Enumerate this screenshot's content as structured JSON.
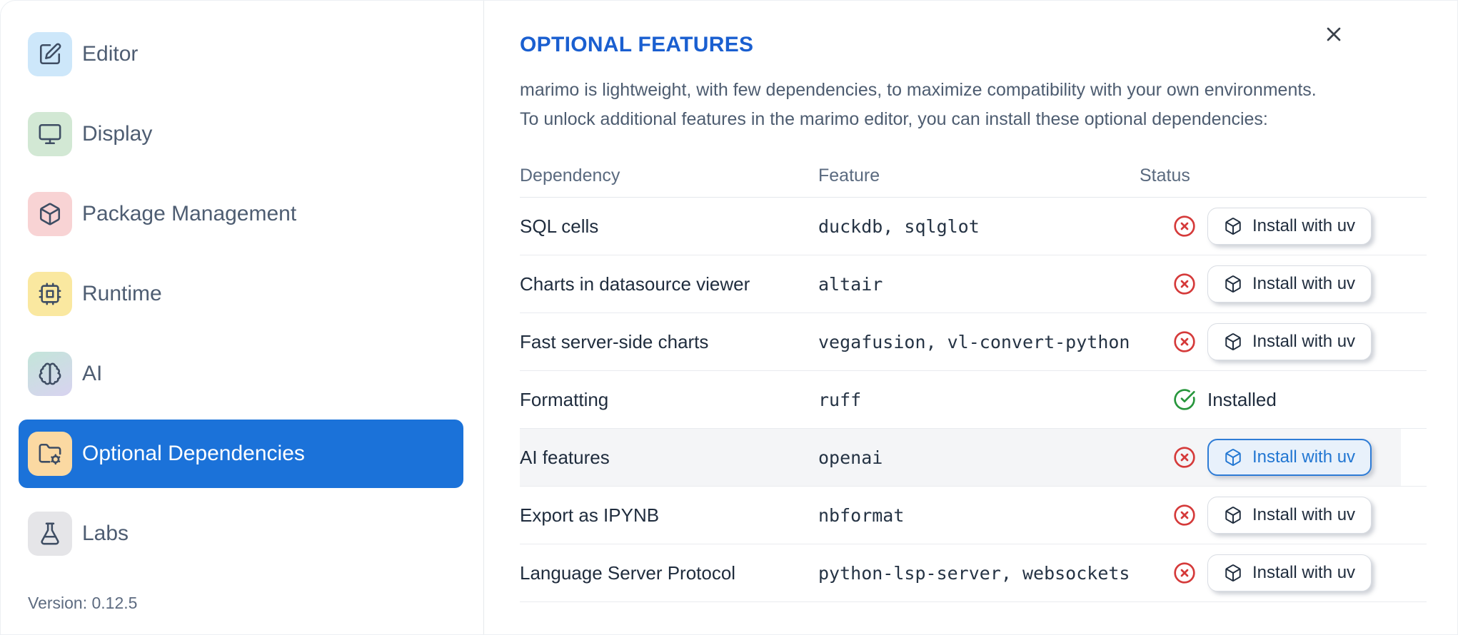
{
  "sidebar": {
    "items": [
      {
        "label": "Editor",
        "icon": "edit-icon",
        "tile": "#cde7fa"
      },
      {
        "label": "Display",
        "icon": "display-icon",
        "tile": "#d2e8d4"
      },
      {
        "label": "Package Management",
        "icon": "package-icon",
        "tile": "#f8d3d4"
      },
      {
        "label": "Runtime",
        "icon": "cpu-icon",
        "tile": "#fae8a0"
      },
      {
        "label": "AI",
        "icon": "brain-icon",
        "tile": "linear-gradient(155deg,#c3e5d9,#d8d3f0)"
      },
      {
        "label": "Optional Dependencies",
        "icon": "folder-cog-icon",
        "tile": "#fbd9a2"
      },
      {
        "label": "Labs",
        "icon": "flask-icon",
        "tile": "#e5e5e8"
      }
    ],
    "selected_index": 5,
    "version_label": "Version: 0.12.5"
  },
  "main": {
    "title": "OPTIONAL FEATURES",
    "description_line1": "marimo is lightweight, with few dependencies, to maximize compatibility with your own environments.",
    "description_line2": "To unlock additional features in the marimo editor, you can install these optional dependencies:",
    "close_icon": "x-icon",
    "table": {
      "headers": [
        "Dependency",
        "Feature",
        "Status"
      ],
      "install_action_label": "Install with uv",
      "installed_label": "Installed",
      "rows": [
        {
          "dependency": "SQL cells",
          "feature": "duckdb, sqlglot",
          "installed": false,
          "highlighted": false
        },
        {
          "dependency": "Charts in datasource viewer",
          "feature": "altair",
          "installed": false,
          "highlighted": false
        },
        {
          "dependency": "Fast server-side charts",
          "feature": "vegafusion, vl-convert-python",
          "installed": false,
          "highlighted": false
        },
        {
          "dependency": "Formatting",
          "feature": "ruff",
          "installed": true,
          "highlighted": false
        },
        {
          "dependency": "AI features",
          "feature": "openai",
          "installed": false,
          "highlighted": true
        },
        {
          "dependency": "Export as IPYNB",
          "feature": "nbformat",
          "installed": false,
          "highlighted": false
        },
        {
          "dependency": "Language Server Protocol",
          "feature": "python-lsp-server, websockets",
          "installed": false,
          "highlighted": false
        }
      ]
    }
  },
  "colors": {
    "accent_blue": "#1b72d9",
    "heading_blue": "#1a5fd0",
    "error_red": "#d53a3a",
    "success_green": "#27963c",
    "row_highlight": "#f4f5f7"
  }
}
